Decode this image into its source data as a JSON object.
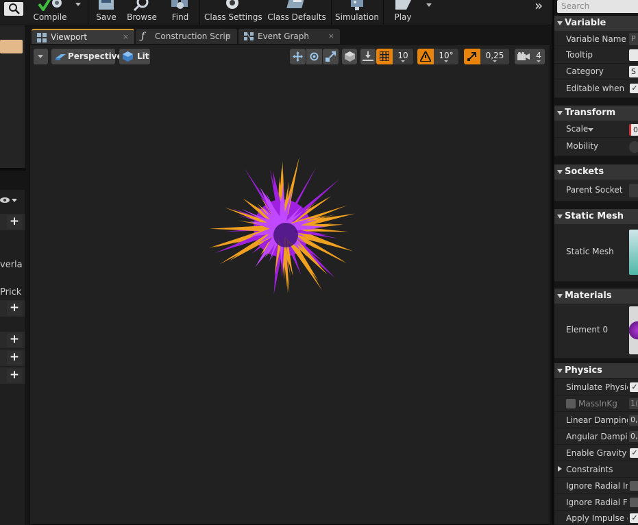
{
  "toolbar": {
    "buttons": [
      {
        "label": "Compile"
      },
      {
        "label": "Save"
      },
      {
        "label": "Browse"
      },
      {
        "label": "Find"
      },
      {
        "label": "Class Settings"
      },
      {
        "label": "Class Defaults"
      },
      {
        "label": "Simulation"
      },
      {
        "label": "Play"
      }
    ],
    "overflow_symbol": "»"
  },
  "left_panel": {
    "partial_texts": [
      "verla",
      "Prick"
    ]
  },
  "tabs": [
    {
      "label": "Viewport",
      "icon": "viewport-icon",
      "active": true
    },
    {
      "label": "Construction Scrip",
      "icon": "function-icon",
      "active": false
    },
    {
      "label": "Event Graph",
      "icon": "graph-icon",
      "active": false
    }
  ],
  "tab_close_symbol": "×",
  "viewport": {
    "view_mode": "Perspective",
    "lighting_mode": "Lit",
    "grid_snap": "10",
    "rotation_snap": "10°",
    "scale_snap": "0,25",
    "camera_speed": "4"
  },
  "details": {
    "search_placeholder": "Search",
    "categories": [
      {
        "title": "Variable",
        "props": [
          "Variable Name",
          "Tooltip",
          "Category",
          "Editable when Inh"
        ]
      },
      {
        "title": "Transform",
        "props": [
          "Scale",
          "Mobility"
        ]
      },
      {
        "title": "Sockets",
        "props": [
          "Parent Socket"
        ]
      },
      {
        "title": "Static Mesh",
        "props": [
          "Static Mesh"
        ]
      },
      {
        "title": "Materials",
        "props": [
          "Element 0"
        ]
      },
      {
        "title": "Physics",
        "props": [
          "Simulate Physics",
          "MassInKg",
          "Linear Damping",
          "Angular Damping",
          "Enable Gravity",
          "Constraints",
          "Ignore Radial Imp",
          "Ignore Radial Forc",
          "Apply Impulse on"
        ]
      }
    ],
    "value_fragments": {
      "variable_name": "P",
      "category": "S",
      "scale": "0",
      "mass": "1(",
      "linear_damping": "0,",
      "angular_damping": "0,"
    }
  },
  "colors": {
    "accent_orange": "#e8830c",
    "tab_active_border": "#d79a2c",
    "spike_orange": "#f0a020",
    "spike_purple": "#a020e0",
    "core_dark_purple": "#3a1070"
  }
}
